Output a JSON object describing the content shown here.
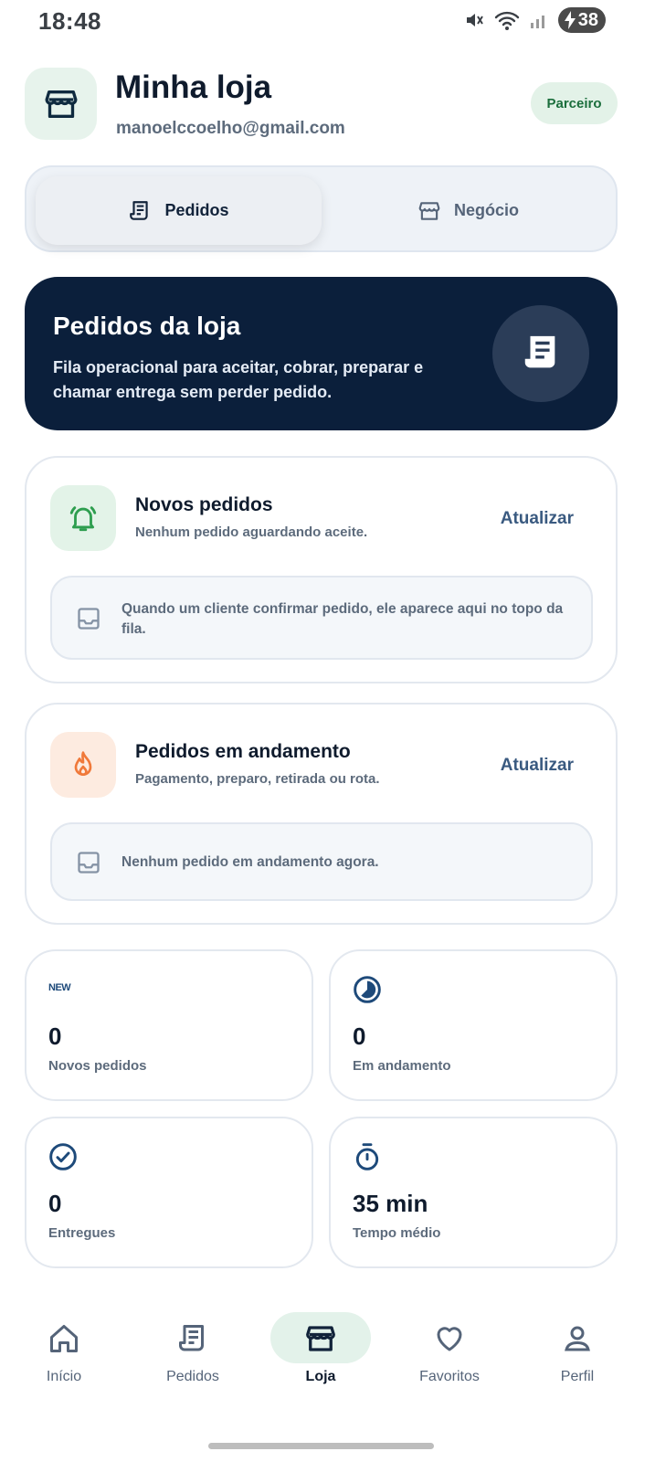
{
  "status_bar": {
    "time": "18:48",
    "battery": "38"
  },
  "header": {
    "store_name": "Minha loja",
    "email": "manoelccoelho@gmail.com",
    "badge": "Parceiro"
  },
  "tabs": [
    {
      "label": "Pedidos",
      "icon": "receipt-icon",
      "active": true
    },
    {
      "label": "Negócio",
      "icon": "store-icon",
      "active": false
    }
  ],
  "hero": {
    "title": "Pedidos da loja",
    "subtitle": "Fila operacional para aceitar, cobrar, preparar e chamar entrega sem perder pedido.",
    "icon": "receipt-icon"
  },
  "cards": {
    "new_orders": {
      "title": "Novos pedidos",
      "subtitle": "Nenhum pedido aguardando aceite.",
      "action": "Atualizar",
      "icon": "bell-ringing-icon",
      "empty_text": "Quando um cliente confirmar pedido, ele aparece aqui no topo da fila.",
      "accent": "#2e9e4f"
    },
    "in_progress": {
      "title": "Pedidos em andamento",
      "subtitle": "Pagamento, preparo, retirada ou rota.",
      "action": "Atualizar",
      "icon": "flame-icon",
      "empty_text": "Nenhum pedido em andamento agora.",
      "accent": "#f0793a"
    }
  },
  "stats": [
    {
      "icon": "new-icon",
      "icon_text": "NEW",
      "value": "0",
      "label": "Novos pedidos"
    },
    {
      "icon": "progress-clock-icon",
      "value": "0",
      "label": "Em andamento"
    },
    {
      "icon": "check-circle-icon",
      "value": "0",
      "label": "Entregues"
    },
    {
      "icon": "timer-icon",
      "value": "35 min",
      "label": "Tempo médio"
    }
  ],
  "nav": [
    {
      "label": "Início",
      "icon": "home-icon",
      "active": false
    },
    {
      "label": "Pedidos",
      "icon": "receipt-icon",
      "active": false
    },
    {
      "label": "Loja",
      "icon": "store-icon",
      "active": true
    },
    {
      "label": "Favoritos",
      "icon": "heart-icon",
      "active": false
    },
    {
      "label": "Perfil",
      "icon": "person-icon",
      "active": false
    }
  ],
  "colors": {
    "primary_dark": "#0b1f3b",
    "accent_green": "#2e9e4f",
    "accent_orange": "#f0793a",
    "link_blue": "#3a5a80"
  }
}
